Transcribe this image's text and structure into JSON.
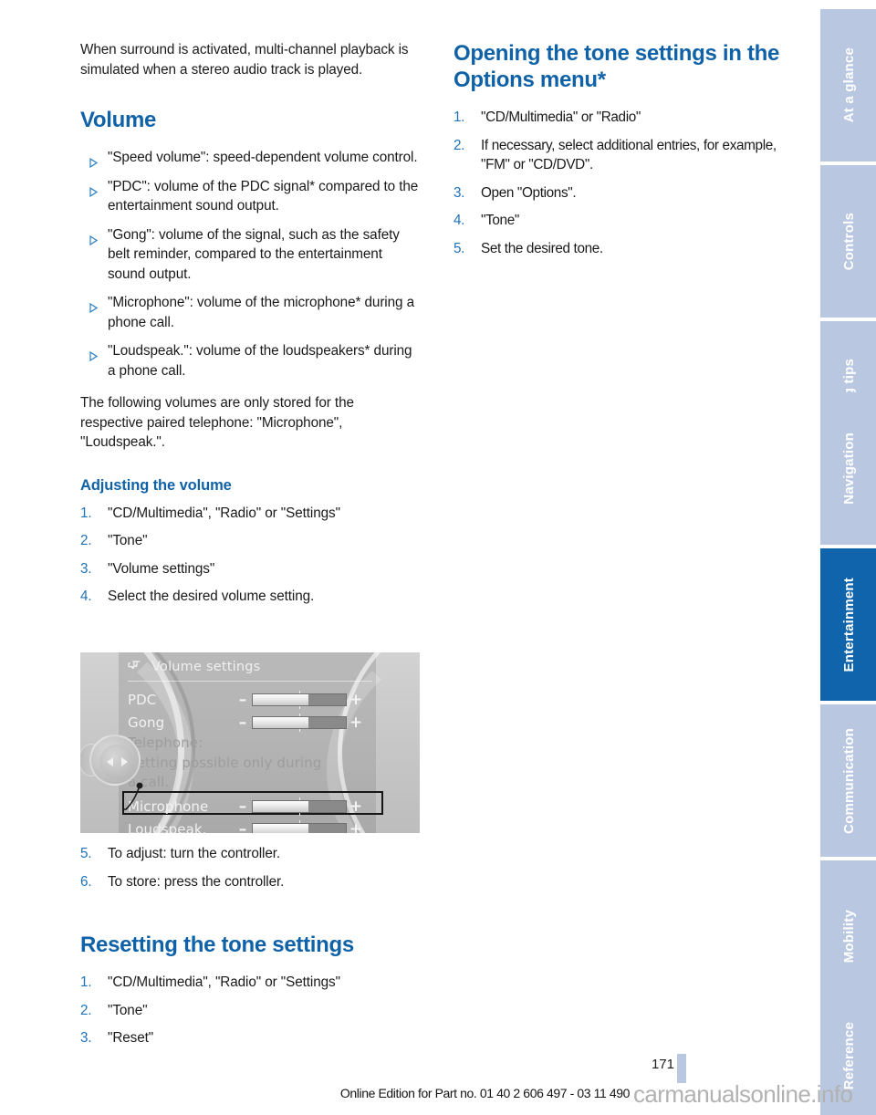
{
  "document": {
    "page_number": "171",
    "footer_text": "Online Edition for Part no. 01 40 2 606 497 - 03 11 490",
    "watermark": "carmanualsonline.info"
  },
  "left_column": {
    "intro_paragraph": "When surround is activated, multi-channel playback is simulated when a stereo audio track is played.",
    "volume_heading": "Volume",
    "volume_bullets": [
      "\"Speed volume\": speed-dependent volume control.",
      "\"PDC\": volume of the PDC signal* compared to the entertainment sound output.",
      "\"Gong\": volume of the signal, such as the safety belt reminder, compared to the entertainment sound output.",
      "\"Microphone\": volume of the microphone* during a phone call.",
      "\"Loudspeak.\": volume of the loudspeakers* during a phone call."
    ],
    "stored_note": "The following volumes are only stored for the respective paired telephone: \"Microphone\", \"Loudspeak.\".",
    "adjusting_heading": "Adjusting the volume",
    "adjusting_steps": [
      {
        "num": "1.",
        "text": "\"CD/Multimedia\", \"Radio\" or \"Settings\""
      },
      {
        "num": "2.",
        "text": "\"Tone\""
      },
      {
        "num": "3.",
        "text": "\"Volume settings\""
      },
      {
        "num": "4.",
        "text": "Select the desired volume setting."
      }
    ],
    "adjusting_steps_after": [
      {
        "num": "5.",
        "text": "To adjust: turn the controller."
      },
      {
        "num": "6.",
        "text": "To store: press the controller."
      }
    ],
    "resetting_heading": "Resetting the tone settings",
    "resetting_steps": [
      {
        "num": "1.",
        "text": "\"CD/Multimedia\", \"Radio\" or \"Settings\""
      },
      {
        "num": "2.",
        "text": "\"Tone\""
      },
      {
        "num": "3.",
        "text": "\"Reset\""
      }
    ]
  },
  "right_column": {
    "opening_heading": "Opening the tone settings in the Options menu*",
    "opening_steps": [
      {
        "num": "1.",
        "text": "\"CD/Multimedia\" or \"Radio\""
      },
      {
        "num": "2.",
        "text": "If necessary, select additional entries, for example, \"FM\" or \"CD/DVD\"."
      },
      {
        "num": "3.",
        "text": "Open \"Options\"."
      },
      {
        "num": "4.",
        "text": "\"Tone\""
      },
      {
        "num": "5.",
        "text": "Set the desired tone."
      }
    ]
  },
  "idrive_figure": {
    "title": "Volume settings",
    "title_icon": "tone-note-icon",
    "rows": [
      {
        "label": "PDC",
        "minus": "–",
        "plus": "+",
        "fill_percent": 60
      },
      {
        "label": "Gong",
        "minus": "–",
        "plus": "+",
        "fill_percent": 60
      },
      {
        "label": "Microphone",
        "minus": "–",
        "plus": "+",
        "fill_percent": 60
      },
      {
        "label": "Loudspeak.",
        "minus": "–",
        "plus": "+",
        "fill_percent": 60
      }
    ],
    "telephone_label": "Telephone:",
    "note_line_1": "Setting possible only during",
    "note_line_2": "a call.",
    "highlighted_row": "Microphone"
  },
  "sidebar": {
    "tabs": [
      {
        "label": "At a glance",
        "active": false
      },
      {
        "label": "Controls",
        "active": false
      },
      {
        "label": "Driving tips",
        "active": false
      },
      {
        "label": "Navigation",
        "active": false
      },
      {
        "label": "Entertainment",
        "active": true
      },
      {
        "label": "Communication",
        "active": false
      },
      {
        "label": "Mobility",
        "active": false
      },
      {
        "label": "Reference",
        "active": false
      }
    ],
    "colors": {
      "inactive": "#b9c8e0",
      "active": "#1064ab"
    }
  },
  "colors": {
    "heading_blue": "#0f62a8",
    "number_blue": "#1f72b8",
    "body_text": "#1b1b1b"
  }
}
